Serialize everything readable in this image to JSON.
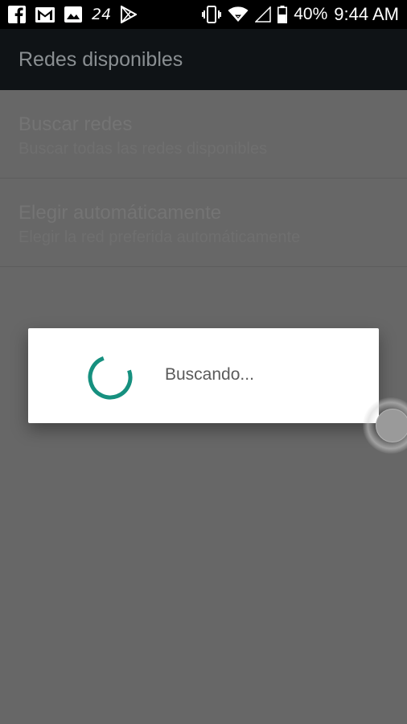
{
  "status_bar": {
    "left_icons": [
      "facebook-icon",
      "gmail-icon",
      "gallery-icon",
      "weather-24-icon",
      "play-store-icon"
    ],
    "weather_temp": "24",
    "right_icons": [
      "vibrate-icon",
      "wifi-icon",
      "signal-icon",
      "battery-icon"
    ],
    "battery": "40%",
    "time": "9:44 AM"
  },
  "toolbar": {
    "title": "Redes disponibles"
  },
  "list": {
    "items": [
      {
        "title": "Buscar redes",
        "summary": "Buscar todas las redes disponibles"
      },
      {
        "title": "Elegir automáticamente",
        "summary": "Elegir la red preferida automáticamente"
      }
    ]
  },
  "dialog": {
    "message": "Buscando...",
    "spinner_color": "#16907f"
  },
  "colors": {
    "scrim": "#676767",
    "toolbar": "#0f1316",
    "accent": "#16907f"
  }
}
